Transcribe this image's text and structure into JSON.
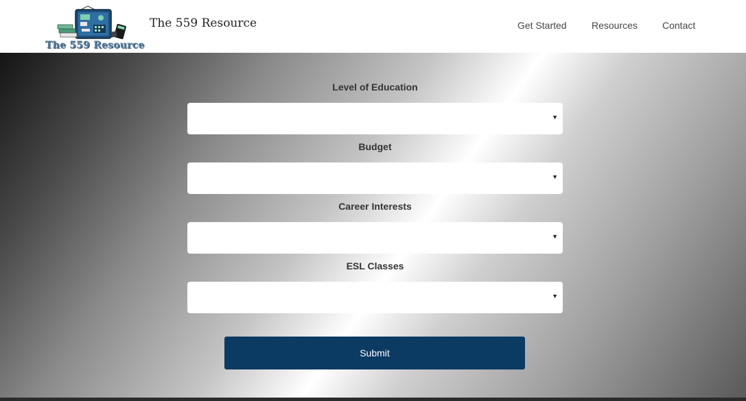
{
  "header": {
    "logo_text": "The 559 Resource",
    "title": "The 559 Resource",
    "nav": [
      {
        "label": "Get Started"
      },
      {
        "label": "Resources"
      },
      {
        "label": "Contact"
      }
    ]
  },
  "form": {
    "fields": [
      {
        "label": "Level of Education",
        "value": ""
      },
      {
        "label": "Budget",
        "value": ""
      },
      {
        "label": "Career Interests",
        "value": ""
      },
      {
        "label": "ESL Classes",
        "value": ""
      }
    ],
    "submit_label": "Submit"
  },
  "colors": {
    "header_bg": "#ffffff",
    "submit_bg": "#0b3a62",
    "submit_text": "#ffffff",
    "label_text": "#333333",
    "nav_text": "#444444"
  },
  "icons": {
    "logo": "blackboard-books-calculator-logo",
    "select_caret": "caret-down-icon"
  }
}
